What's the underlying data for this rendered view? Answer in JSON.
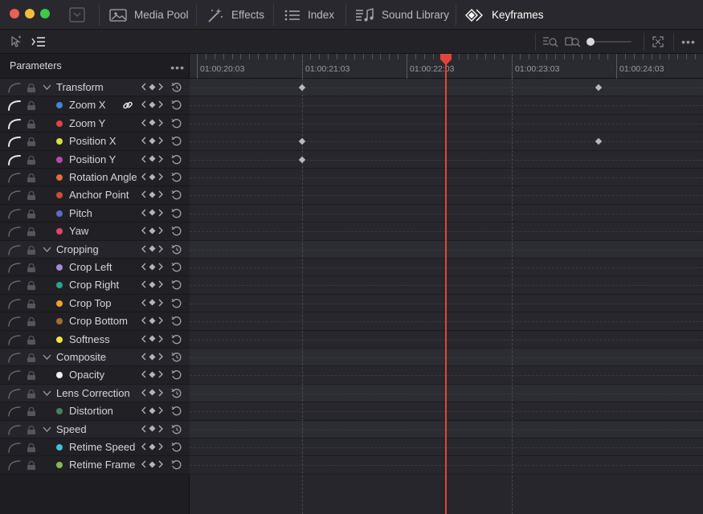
{
  "toolbar": {
    "items": [
      {
        "label": "Media Pool",
        "icon": "media-pool-icon",
        "active": false
      },
      {
        "label": "Effects",
        "icon": "effects-wand-icon",
        "active": false
      },
      {
        "label": "Index",
        "icon": "index-list-icon",
        "active": false
      },
      {
        "label": "Sound Library",
        "icon": "sound-library-icon",
        "active": false
      },
      {
        "label": "Keyframes",
        "icon": "keyframes-icon",
        "active": true
      }
    ]
  },
  "panel": {
    "title": "Parameters",
    "more": "•••"
  },
  "ruler": {
    "timecodes": [
      "01:00:20:03",
      "01:00:21:03",
      "01:00:22:03",
      "01:00:23:03",
      "01:00:24:03"
    ]
  },
  "parameters": [
    {
      "label": "Transform",
      "type": "group"
    },
    {
      "label": "Zoom X",
      "type": "child",
      "color": "#3f86d6",
      "curve_active": true,
      "linked": true
    },
    {
      "label": "Zoom Y",
      "type": "child",
      "color": "#e0434b",
      "curve_active": true
    },
    {
      "label": "Position X",
      "type": "child",
      "color": "#d7dc45",
      "curve_active": true
    },
    {
      "label": "Position Y",
      "type": "child",
      "color": "#b748b6",
      "curve_active": true
    },
    {
      "label": "Rotation Angle",
      "type": "child",
      "color": "#e46a3d"
    },
    {
      "label": "Anchor Point",
      "type": "child",
      "color": "#cf4d2f"
    },
    {
      "label": "Pitch",
      "type": "child",
      "color": "#5f68c6"
    },
    {
      "label": "Yaw",
      "type": "child",
      "color": "#e0446d"
    },
    {
      "label": "Cropping",
      "type": "group"
    },
    {
      "label": "Crop Left",
      "type": "child",
      "color": "#a48ad6"
    },
    {
      "label": "Crop Right",
      "type": "child",
      "color": "#29a38f"
    },
    {
      "label": "Crop Top",
      "type": "child",
      "color": "#f1a22b"
    },
    {
      "label": "Crop Bottom",
      "type": "child",
      "color": "#9f6f35"
    },
    {
      "label": "Softness",
      "type": "child",
      "color": "#f3e43a"
    },
    {
      "label": "Composite",
      "type": "group"
    },
    {
      "label": "Opacity",
      "type": "child",
      "color": "#f0f0f0"
    },
    {
      "label": "Lens Correction",
      "type": "group"
    },
    {
      "label": "Distortion",
      "type": "child",
      "color": "#4c7f5c"
    },
    {
      "label": "Speed",
      "type": "group"
    },
    {
      "label": "Retime Speed",
      "type": "child",
      "color": "#3ec3d6"
    },
    {
      "label": "Retime Frame",
      "type": "child",
      "color": "#88b94c"
    }
  ],
  "keyframes": [
    {
      "row": 0,
      "time": "01:00:21:03"
    },
    {
      "row": 0,
      "time": "01:00:23:23"
    },
    {
      "row": 3,
      "time": "01:00:21:03"
    },
    {
      "row": 3,
      "time": "01:00:23:23"
    },
    {
      "row": 4,
      "time": "01:00:21:03"
    }
  ],
  "playhead": {
    "time": "01:00:22:12",
    "color": "#e2453c"
  }
}
